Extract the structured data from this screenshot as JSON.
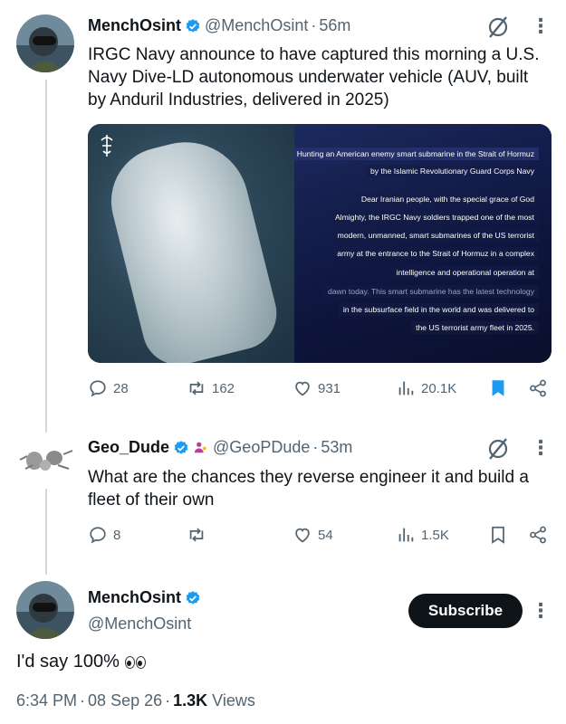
{
  "colors": {
    "verified_blue": "#1d9bf0",
    "bookmark_active": "#1d9bf0",
    "text_primary": "#0f1419",
    "text_secondary": "#536471",
    "subscribe_bg": "#0f1419"
  },
  "post1": {
    "display_name": "MenchOsint",
    "handle": "@MenchOsint",
    "separator": "·",
    "time": "56m",
    "text_line1": "IRGC Navy announce to have captured this morning a U.S.",
    "text_line2": "Navy Dive-LD autonomous underwater vehicle (AUV, built",
    "text_line3": "by Anduril Industries, delivered in 2025)",
    "media": {
      "caption_lines": [
        "Hunting an American enemy smart submarine in the Strait of Hormuz",
        "by the Islamic Revolutionary Guard Corps Navy",
        "Dear Iranian people, with the special grace of God",
        "Almighty, the IRGC Navy soldiers trapped one of the most",
        "modern, unmanned, smart submarines of the US terrorist",
        "army at the entrance to the Strait of Hormuz in a complex",
        "intelligence and operational operation at",
        "dawn today. This smart submarine has the latest technology",
        "in the subsurface field in the world and was delivered to",
        "the US terrorist army fleet in 2025."
      ]
    },
    "replies": "28",
    "reposts": "162",
    "likes": "931",
    "views": "20.1K",
    "bookmarked": true
  },
  "post2": {
    "display_name": "Geo_Dude",
    "handle": "@GeoPDude",
    "separator": "·",
    "time": "53m",
    "text_line1": "What are the chances they reverse engineer it and build a",
    "text_line2": "fleet of their own",
    "replies": "8",
    "reposts": "",
    "likes": "54",
    "views": "1.5K",
    "bookmarked": false
  },
  "post3": {
    "display_name": "MenchOsint",
    "handle": "@MenchOsint",
    "subscribe_label": "Subscribe",
    "text": "I'd say 100%",
    "time": "6:34 PM",
    "separator": "·",
    "date": "08 Sep 26",
    "views_count": "1.3K",
    "views_label": "Views"
  }
}
